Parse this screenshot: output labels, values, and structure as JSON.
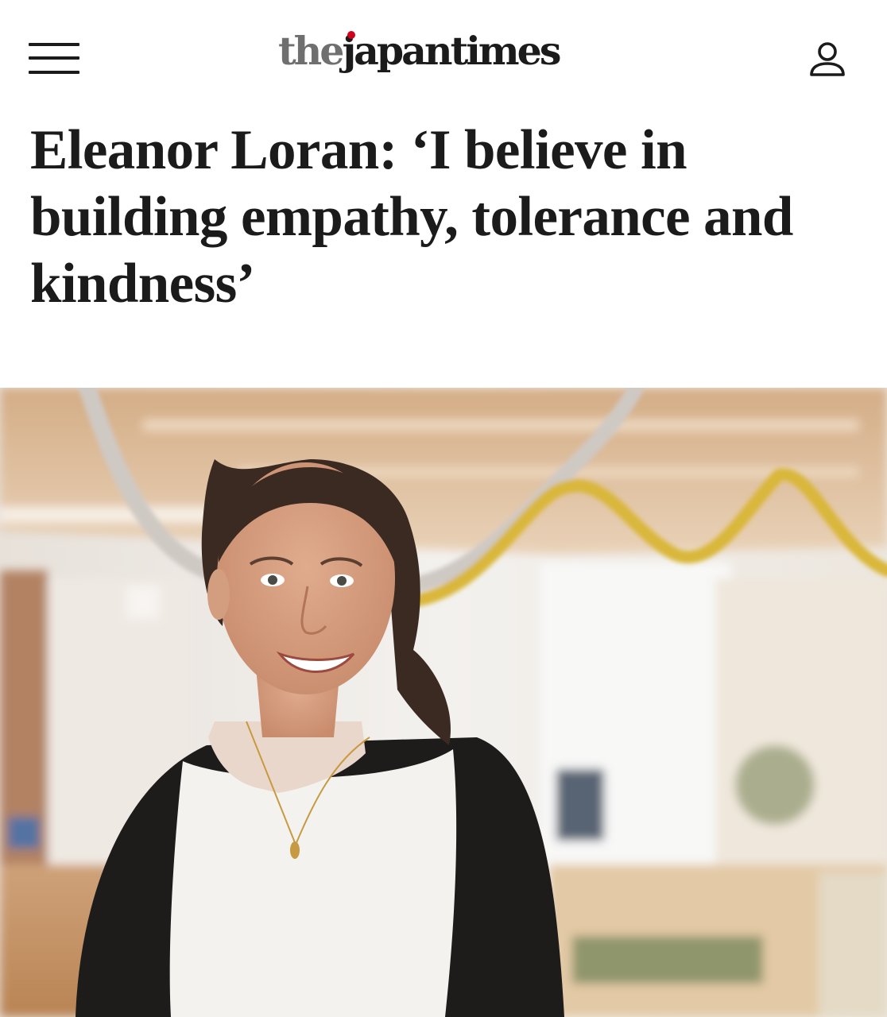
{
  "header": {
    "menu_icon": "hamburger-menu-icon",
    "logo": {
      "the": "the",
      "japan": "japan",
      "times": "times",
      "brand_red": "#d0021b",
      "brand_gray": "#6f6f6f"
    },
    "account_icon": "user-account-icon"
  },
  "article": {
    "headline": "Eleanor Loran: ‘I believe in building empathy, tolerance and kindness’",
    "hero_image": {
      "icon": "photo"
    }
  },
  "colors": {
    "text": "#1b1b1b",
    "background": "#ffffff"
  }
}
